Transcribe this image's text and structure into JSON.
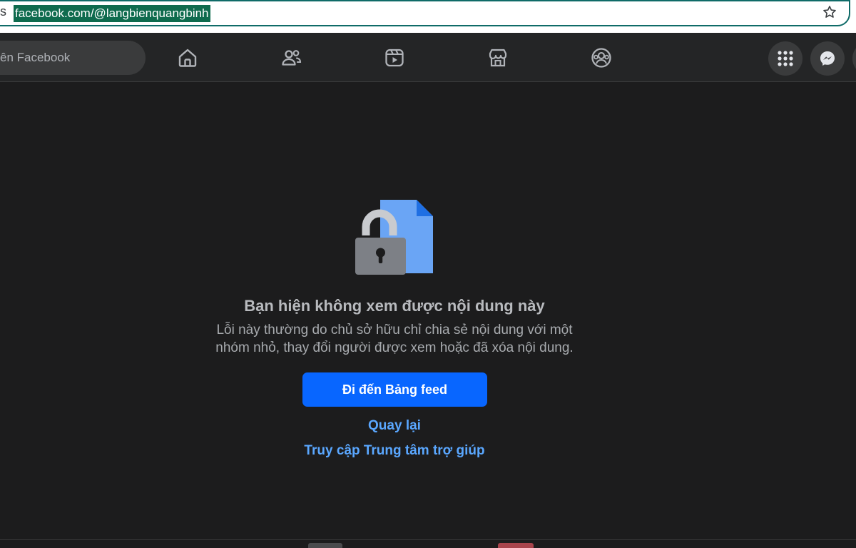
{
  "browser": {
    "tab_edge": "s",
    "url": "facebook.com/@langbienquangbinh",
    "bookmark_icon": "star-icon"
  },
  "nav": {
    "search_placeholder": "ên Facebook",
    "icons": [
      "home-icon",
      "friends-icon",
      "video-icon",
      "marketplace-icon",
      "groups-icon"
    ],
    "right_buttons": [
      "menu-grid-icon",
      "messenger-icon"
    ]
  },
  "content": {
    "illustration": "locked-content-icon",
    "title": "Bạn hiện không xem được nội dung này",
    "body_line1": "Lỗi này thường do chủ sở hữu chỉ chia sẻ nội dung với một",
    "body_line2": "nhóm nhỏ, thay đổi người được xem hoặc đã xóa nội dung.",
    "primary_button": "Đi đến Bảng feed",
    "back_link": "Quay lại",
    "help_link": "Truy cập Trung tâm trợ giúp"
  },
  "colors": {
    "accent": "#0866ff",
    "link": "#5aa7ff",
    "background": "#1c1c1d",
    "nav_background": "#242526",
    "url_highlight": "#0f6b4e"
  }
}
